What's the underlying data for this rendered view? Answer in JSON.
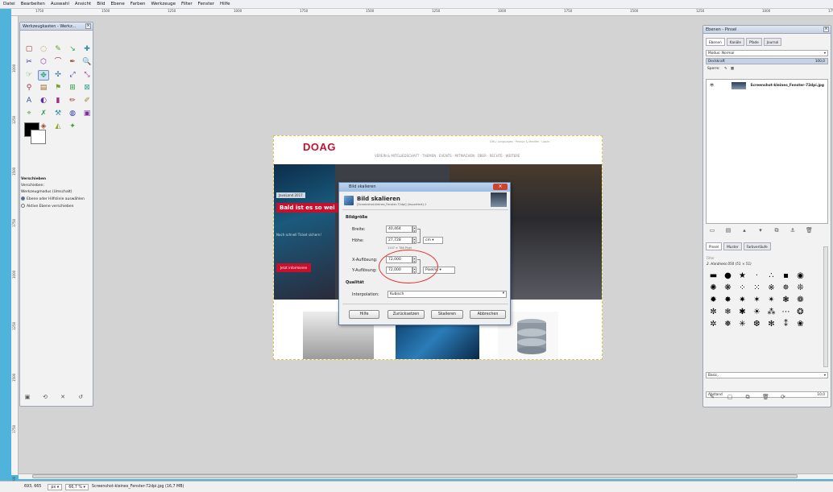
{
  "menu": [
    "Datei",
    "Bearbeiten",
    "Auswahl",
    "Ansicht",
    "Bild",
    "Ebene",
    "Farben",
    "Werkzeuge",
    "Filter",
    "Fenster",
    "Hilfe"
  ],
  "ruler": {
    "top_ticks": [
      "1750",
      "1500",
      "1250",
      "1000",
      "1750",
      "1500",
      "1250",
      "1000",
      "1750",
      "1500",
      "1250",
      "1000",
      "1750"
    ],
    "left_ticks": [
      "1000",
      "1250",
      "1500",
      "1750",
      "1000",
      "1250",
      "1500",
      "1750",
      "1000"
    ]
  },
  "toolbox": {
    "title": "Werkzeugkasten - Werkz...",
    "tools": [
      "▢",
      "◌",
      "✎",
      "↘",
      "✚",
      "✂",
      "⬡",
      "⌒",
      "✒",
      "🔍",
      "☞",
      "✥",
      "✣",
      "⤢",
      "⤡",
      "⚲",
      "▤",
      "⚑",
      "⊞",
      "⊠",
      "A",
      "◐",
      "▮",
      "✏",
      "✐",
      "⌖",
      "✗",
      "⚒",
      "◍",
      "▣",
      "◉",
      "◈",
      "◭",
      "✦"
    ],
    "active_tool_index": 11,
    "fg_color": "#000000",
    "bg_color": "#ffffff",
    "options_title": "Verschieben",
    "options_line1": "Verschieben:",
    "mode_label": "Werkzeugmodus (Umschalt)",
    "radio_1": "Ebene oder Hilfslinie auswählen",
    "radio_2": "Aktive Ebene verschieben"
  },
  "image": {
    "logo": "DOAG",
    "nav": "VEREIN & MITGLIEDSCHAFT ·   THEMEN ·   EVENTS ·   MITMACHEN ·   ÜBER ·   RECHTE   ·   WEITERE",
    "top_links": "DHL/ Languages   ·   Presse & Medien   ·   Login",
    "tag": "JavaLand 2017",
    "headline": "Bald ist es so wei",
    "sub": "Noch schnell Ticket sichern!",
    "cta": "Jetzt informieren"
  },
  "dialog": {
    "window_title": "Bild skalieren",
    "heading": "Bild skalieren",
    "subheading": "[Screenshot-kleines_Fenster-72dpi] (importiert)-1",
    "section_size": "Bildgröße",
    "width_label": "Breite:",
    "width_value": "40,464",
    "height_label": "Höhe:",
    "height_value": "27,728",
    "unit": "cm",
    "size_info": "1147 × 786 Pixel",
    "xres_label": "X-Auflösung:",
    "xres_value": "72,000",
    "yres_label": "Y-Auflösung:",
    "yres_value": "72,000",
    "res_unit": "Pixel/in",
    "section_quality": "Qualität",
    "interp_label": "Interpolation:",
    "interp_value": "Kubisch",
    "btn_help": "Hilfe",
    "btn_reset": "Zurücksetzen",
    "btn_scale": "Skalieren",
    "btn_cancel": "Abbrechen",
    "highlight_color": "#e5332a"
  },
  "layers": {
    "title": "Ebenen - Pinsel",
    "tabs": [
      "Ebenen",
      "Kanäle",
      "Pfade",
      "Journal"
    ],
    "mode_label": "Modus: Normal",
    "opacity_label": "Deckkraft",
    "opacity_value": "100,0",
    "lock_label": "Sperre:",
    "layer_name": "Screenshot-kleines_Fenster-72dpi.jpg",
    "brush_tabs": [
      "Pinsel",
      "Muster",
      "Farbverläufe"
    ],
    "brush_filter": "Filter",
    "brush_name": "2. Hardness 050 (51 × 51)",
    "brushes": [
      "▬",
      "●",
      "★",
      "·",
      "∴",
      "▪",
      "◉",
      "✺",
      "❋",
      "⁘",
      "⁙",
      "※",
      "✵",
      "❊",
      "✹",
      "✸",
      "✷",
      "✶",
      "✴",
      "❃",
      "❁",
      "✼",
      "❄",
      "✱",
      "☀",
      "⁂",
      "⋯",
      "❂",
      "✲",
      "❅",
      "✳",
      "❆",
      "✻",
      "⁑",
      "❀"
    ],
    "preset": "Basic,",
    "spacing_label": "Abstand",
    "spacing_value": "10,0"
  },
  "status": {
    "coords": "693, 665",
    "unit": "px",
    "zoom": "66,7 %",
    "file_info": "Screenshot-kleines_Fenster-72dpi.jpg (16,7 MB)"
  }
}
